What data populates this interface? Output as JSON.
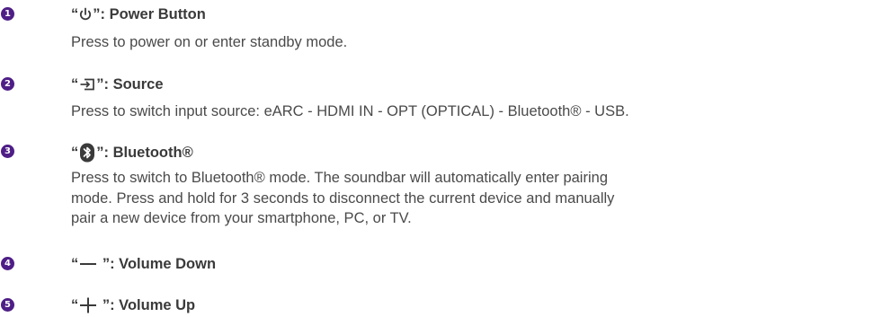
{
  "items": [
    {
      "number": "1",
      "icon": "power-icon",
      "open_quote": "“",
      "close": "”: ",
      "name": "Power Button",
      "description_lines": [
        "Press to power on or enter standby mode."
      ]
    },
    {
      "number": "2",
      "icon": "source-input-icon",
      "open_quote": "“",
      "close": "”: ",
      "name": "Source",
      "description_lines": [
        "Press to switch input source: eARC - HDMI IN - OPT (OPTICAL) - Bluetooth®  - USB."
      ]
    },
    {
      "number": "3",
      "icon": "bluetooth-icon",
      "open_quote": "“",
      "close": "”: ",
      "name": "Bluetooth®",
      "description_lines": [
        "Press to switch to Bluetooth® mode. The soundbar will automatically enter pairing",
        "mode. Press and hold for 3 seconds to disconnect the current device and manually",
        "pair a new device from your smartphone, PC, or TV."
      ]
    },
    {
      "number": "4",
      "icon": "minus-icon",
      "open_quote": "“",
      "close": " ”: ",
      "name": "Volume Down",
      "description_lines": []
    },
    {
      "number": "5",
      "icon": "plus-icon",
      "open_quote": "“",
      "close": " ”: ",
      "name": "Volume Up",
      "description_lines": []
    }
  ],
  "colors": {
    "badge": "#4e1e86",
    "text": "#3a3a3a"
  }
}
